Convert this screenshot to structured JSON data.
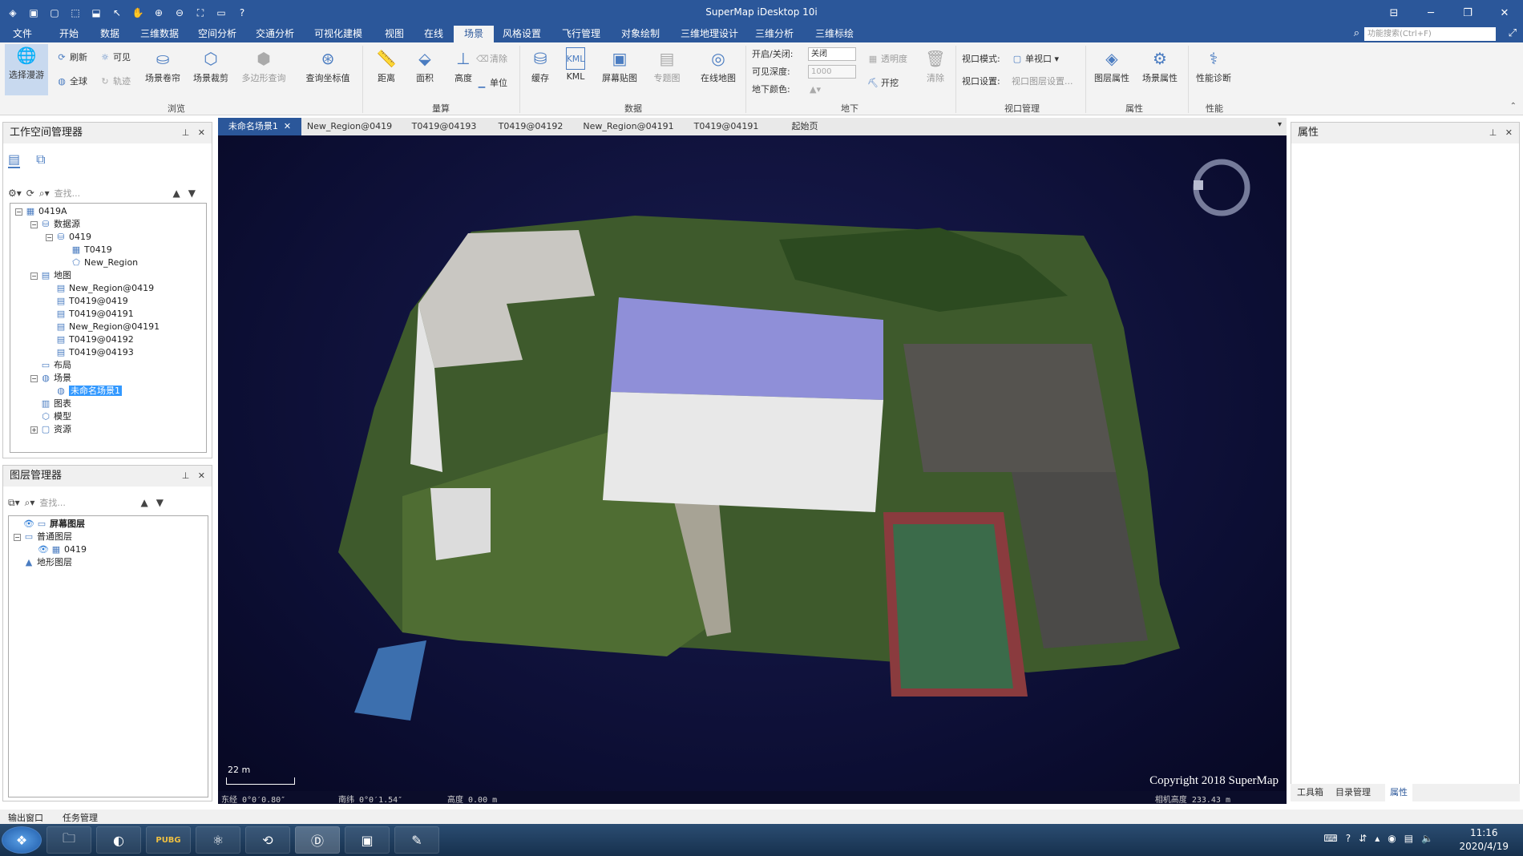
{
  "app": {
    "title": "SuperMap iDesktop 10i"
  },
  "qat_icons": [
    "app-logo-icon",
    "save-icon",
    "new-icon",
    "undo-icon",
    "redo-icon",
    "select-icon",
    "pan-icon",
    "zoom-in-icon",
    "zoom-out-icon",
    "fullextent-icon",
    "open-icon",
    "help-icon"
  ],
  "menu": {
    "tabs": [
      "文件",
      "开始",
      "数据",
      "三维数据",
      "空间分析",
      "交通分析",
      "可视化建模",
      "视图",
      "在线",
      "场景",
      "风格设置",
      "飞行管理",
      "对象绘制",
      "三维地理设计",
      "三维分析",
      "三维标绘"
    ],
    "active": "场景",
    "search_placeholder": "功能搜索(Ctrl+F)"
  },
  "ribbon": {
    "browse": {
      "label": "浏览",
      "select_roam": "选择漫游",
      "refresh": "刷新",
      "visible": "可见",
      "full": "全球",
      "track": "轨迹",
      "scene_shutter": "场景卷帘",
      "scene_clip": "场景裁剪",
      "polygon_query": "多边形查询",
      "query_coord": "查询坐标值"
    },
    "measure": {
      "label": "量算",
      "distance": "距离",
      "area": "面积",
      "height": "高度",
      "clear": "清除",
      "unit": "单位"
    },
    "data": {
      "label": "数据",
      "cache": "缓存",
      "kml": "KML",
      "screen_texture": "屏幕贴图",
      "thematic": "专题图",
      "online_map": "在线地图"
    },
    "underground": {
      "label": "地下",
      "onoff_label": "开启/关闭:",
      "onoff_value": "关闭",
      "depth_label": "可见深度:",
      "depth_value": "1000",
      "color_label": "地下颜色:",
      "transparency": "透明度",
      "dig": "开挖",
      "clear": "清除"
    },
    "viewport": {
      "label": "视口管理",
      "mode_label": "视口模式:",
      "mode_value": "单视口",
      "setting_label": "视口设置:",
      "setting_value": "视口图层设置..."
    },
    "attributes": {
      "label": "属性",
      "layer_attr": "图层属性",
      "scene_attr": "场景属性"
    },
    "performance": {
      "label": "性能",
      "diagnose": "性能诊断"
    }
  },
  "workspace": {
    "title": "工作空间管理器",
    "search": "查找...",
    "tree": [
      {
        "d": 0,
        "t": "-",
        "i": "workspace",
        "label": "0419A"
      },
      {
        "d": 1,
        "t": "-",
        "i": "datasource-group",
        "label": "数据源"
      },
      {
        "d": 2,
        "t": "-",
        "i": "datasource",
        "label": "0419"
      },
      {
        "d": 3,
        "t": "",
        "i": "grid",
        "label": "T0419"
      },
      {
        "d": 3,
        "t": "",
        "i": "region",
        "label": "New_Region"
      },
      {
        "d": 1,
        "t": "-",
        "i": "map-group",
        "label": "地图"
      },
      {
        "d": 2,
        "t": "",
        "i": "map",
        "label": "New_Region@0419"
      },
      {
        "d": 2,
        "t": "",
        "i": "map",
        "label": "T0419@0419"
      },
      {
        "d": 2,
        "t": "",
        "i": "map",
        "label": "T0419@04191"
      },
      {
        "d": 2,
        "t": "",
        "i": "map",
        "label": "New_Region@04191"
      },
      {
        "d": 2,
        "t": "",
        "i": "map",
        "label": "T0419@04192"
      },
      {
        "d": 2,
        "t": "",
        "i": "map",
        "label": "T0419@04193"
      },
      {
        "d": 1,
        "t": "",
        "i": "layout",
        "label": "布局"
      },
      {
        "d": 1,
        "t": "-",
        "i": "scene-group",
        "label": "场景"
      },
      {
        "d": 2,
        "t": "",
        "i": "scene",
        "label": "未命名场景1",
        "sel": true
      },
      {
        "d": 1,
        "t": "",
        "i": "symbol",
        "label": "图表"
      },
      {
        "d": 1,
        "t": "",
        "i": "model",
        "label": "模型"
      },
      {
        "d": 1,
        "t": "+",
        "i": "resource",
        "label": "资源"
      }
    ]
  },
  "layers": {
    "title": "图层管理器",
    "search": "查找...",
    "tree": [
      {
        "d": 0,
        "t": "",
        "i": "screen-layer",
        "label": "屏幕图层",
        "bold": true,
        "eye": true
      },
      {
        "d": 0,
        "t": "-",
        "i": "normal-layer",
        "label": "普通图层"
      },
      {
        "d": 1,
        "t": "",
        "i": "layer",
        "label": "0419",
        "eye": true
      },
      {
        "d": 0,
        "t": "",
        "i": "terrain-layer",
        "label": "地形图层"
      }
    ]
  },
  "doc_tabs": [
    "未命名场景1",
    "New_Region@0419",
    "T0419@04193",
    "T0419@04192",
    "New_Region@04191",
    "T0419@04191",
    "起始页"
  ],
  "scene": {
    "scale_label": "22 m",
    "copyright": "Copyright 2018 SuperMap",
    "coord_lon": "东经 0°0′0.80″",
    "coord_lat": "南纬 0°0′1.54″",
    "coord_alt": "高度 0.00 m",
    "camera_alt": "相机高度 233.43 m"
  },
  "attr_panel": {
    "title": "属性",
    "tabs": [
      "工具箱",
      "目录管理",
      "属性"
    ],
    "active": "属性"
  },
  "bottom_tabs": [
    "输出窗口",
    "任务管理"
  ],
  "taskbar": {
    "apps": [
      "start-orb-icon",
      "explorer-icon",
      "browser-icon",
      "pubg-icon",
      "atom-icon",
      "sync-icon",
      "supermap-icon",
      "app-window-icon",
      "notes-icon"
    ],
    "time": "11:16",
    "date": "2020/4/19"
  }
}
